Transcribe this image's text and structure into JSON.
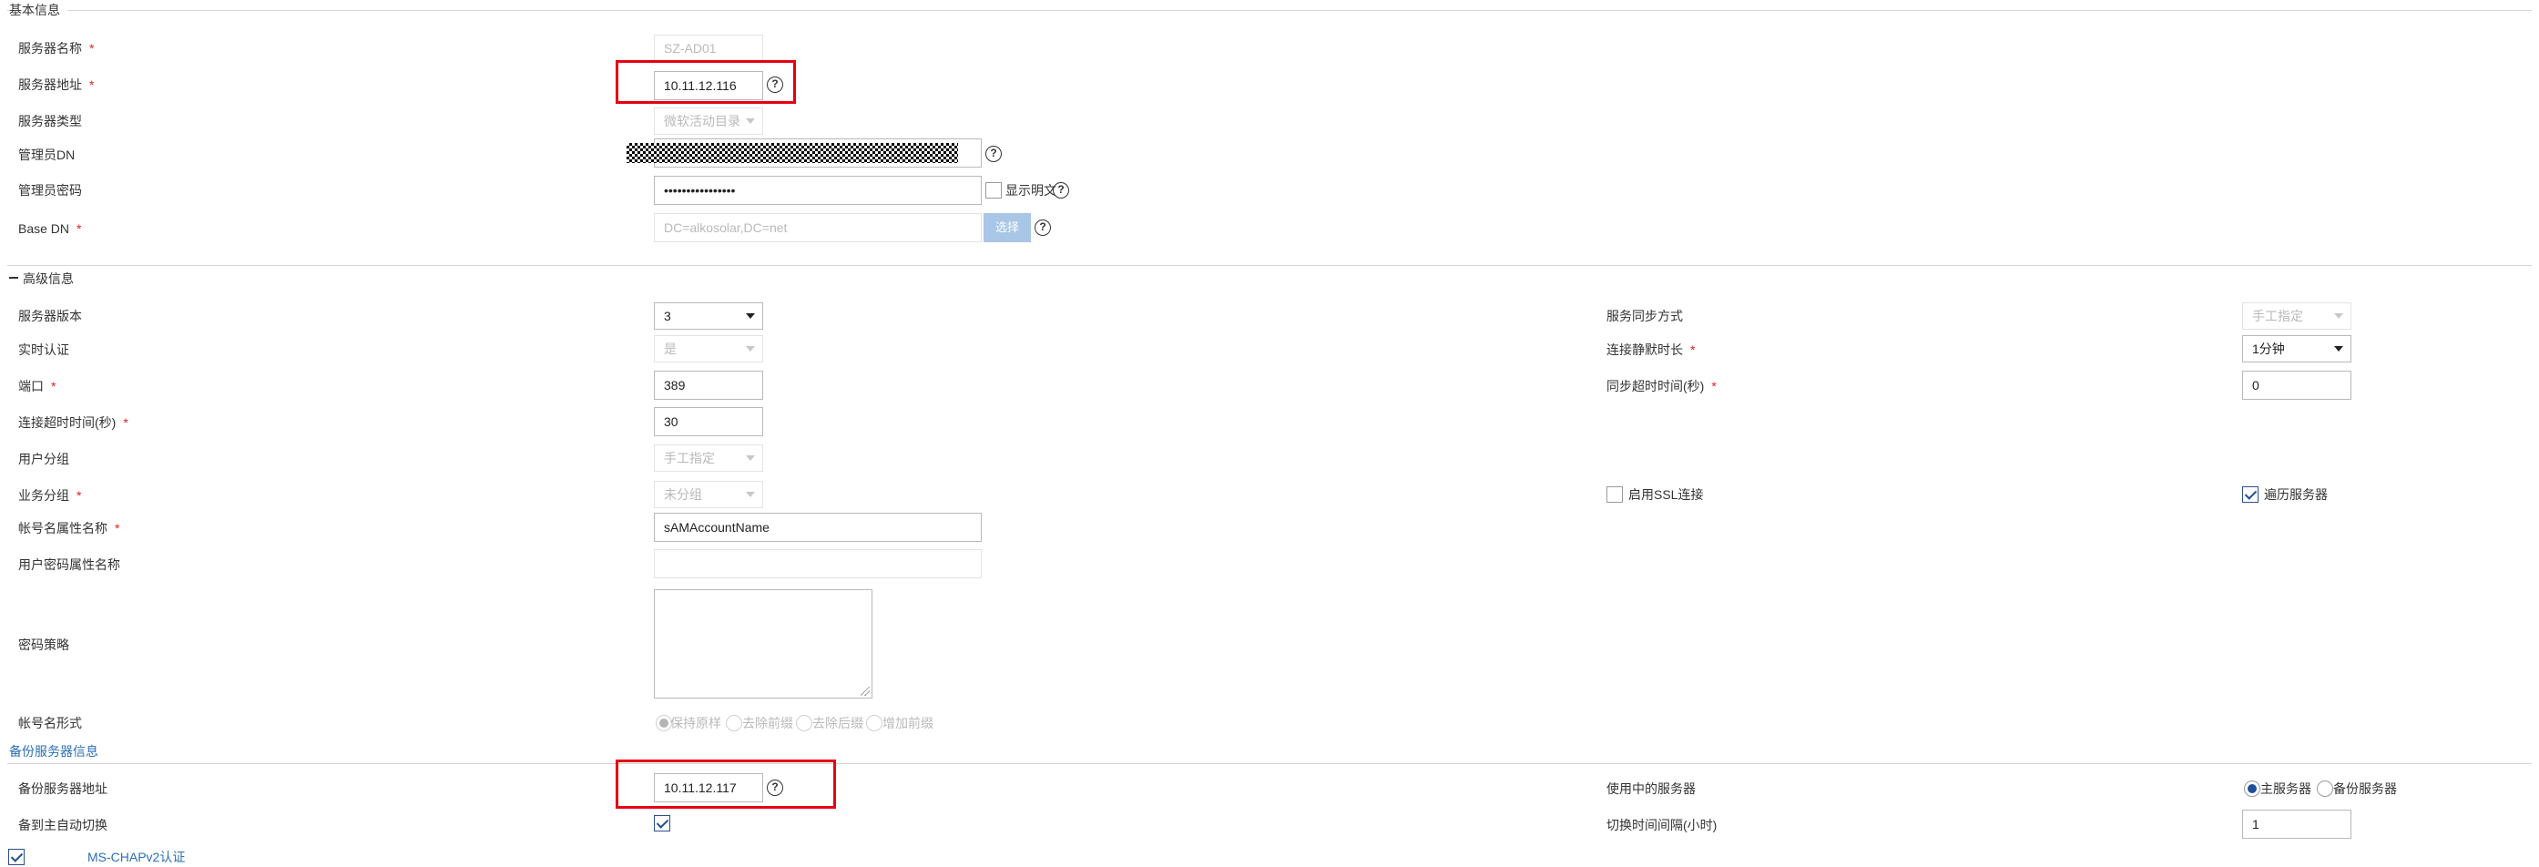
{
  "basic": {
    "title": "基本信息",
    "server_name_label": "服务器名称",
    "server_name_value": "SZ-AD01",
    "server_addr_label": "服务器地址",
    "server_addr_value": "10.11.12.116",
    "server_type_label": "服务器类型",
    "server_type_value": "微软活动目录",
    "admin_dn_label": "管理员DN",
    "admin_pwd_label": "管理员密码",
    "admin_pwd_value": "••••••••••••••••",
    "show_plain_label": "显示明文",
    "base_dn_label": "Base DN",
    "base_dn_value": "DC=alkosolar,DC=net",
    "select_button": "选择"
  },
  "advanced": {
    "title": "高级信息",
    "version_label": "服务器版本",
    "version_value": "3",
    "realtime_auth_label": "实时认证",
    "realtime_auth_value": "是",
    "port_label": "端口",
    "port_value": "389",
    "conn_timeout_label": "连接超时时间(秒)",
    "conn_timeout_value": "30",
    "user_group_label": "用户分组",
    "user_group_value": "手工指定",
    "biz_group_label": "业务分组",
    "biz_group_value": "未分组",
    "account_attr_label": "帐号名属性名称",
    "account_attr_value": "sAMAccountName",
    "pwd_attr_label": "用户密码属性名称",
    "pwd_attr_value": "",
    "pwd_policy_label": "密码策略",
    "account_form_label": "帐号名形式",
    "account_form_options": [
      "保持原样",
      "去除前缀",
      "去除后缀",
      "增加前缀"
    ],
    "sync_mode_label": "服务同步方式",
    "sync_mode_value": "手工指定",
    "idle_label": "连接静默时长",
    "idle_value": "1分钟",
    "sync_timeout_label": "同步超时时间(秒)",
    "sync_timeout_value": "0",
    "ssl_label": "启用SSL连接",
    "traverse_label": "遍历服务器"
  },
  "backup": {
    "title": "备份服务器信息",
    "addr_label": "备份服务器地址",
    "addr_value": "10.11.12.117",
    "auto_switch_label": "备到主自动切换",
    "in_use_label": "使用中的服务器",
    "primary_label": "主服务器",
    "backup_label": "备份服务器",
    "switch_interval_label": "切换时间间隔(小时)",
    "switch_interval_value": "1"
  },
  "mschap": {
    "label": "MS-CHAPv2认证"
  },
  "icons": {
    "help": "?"
  },
  "colors": {
    "highlight": "#e60012",
    "link": "#2a6fb6",
    "required": "#e02020",
    "button": "#a8c6e6"
  }
}
